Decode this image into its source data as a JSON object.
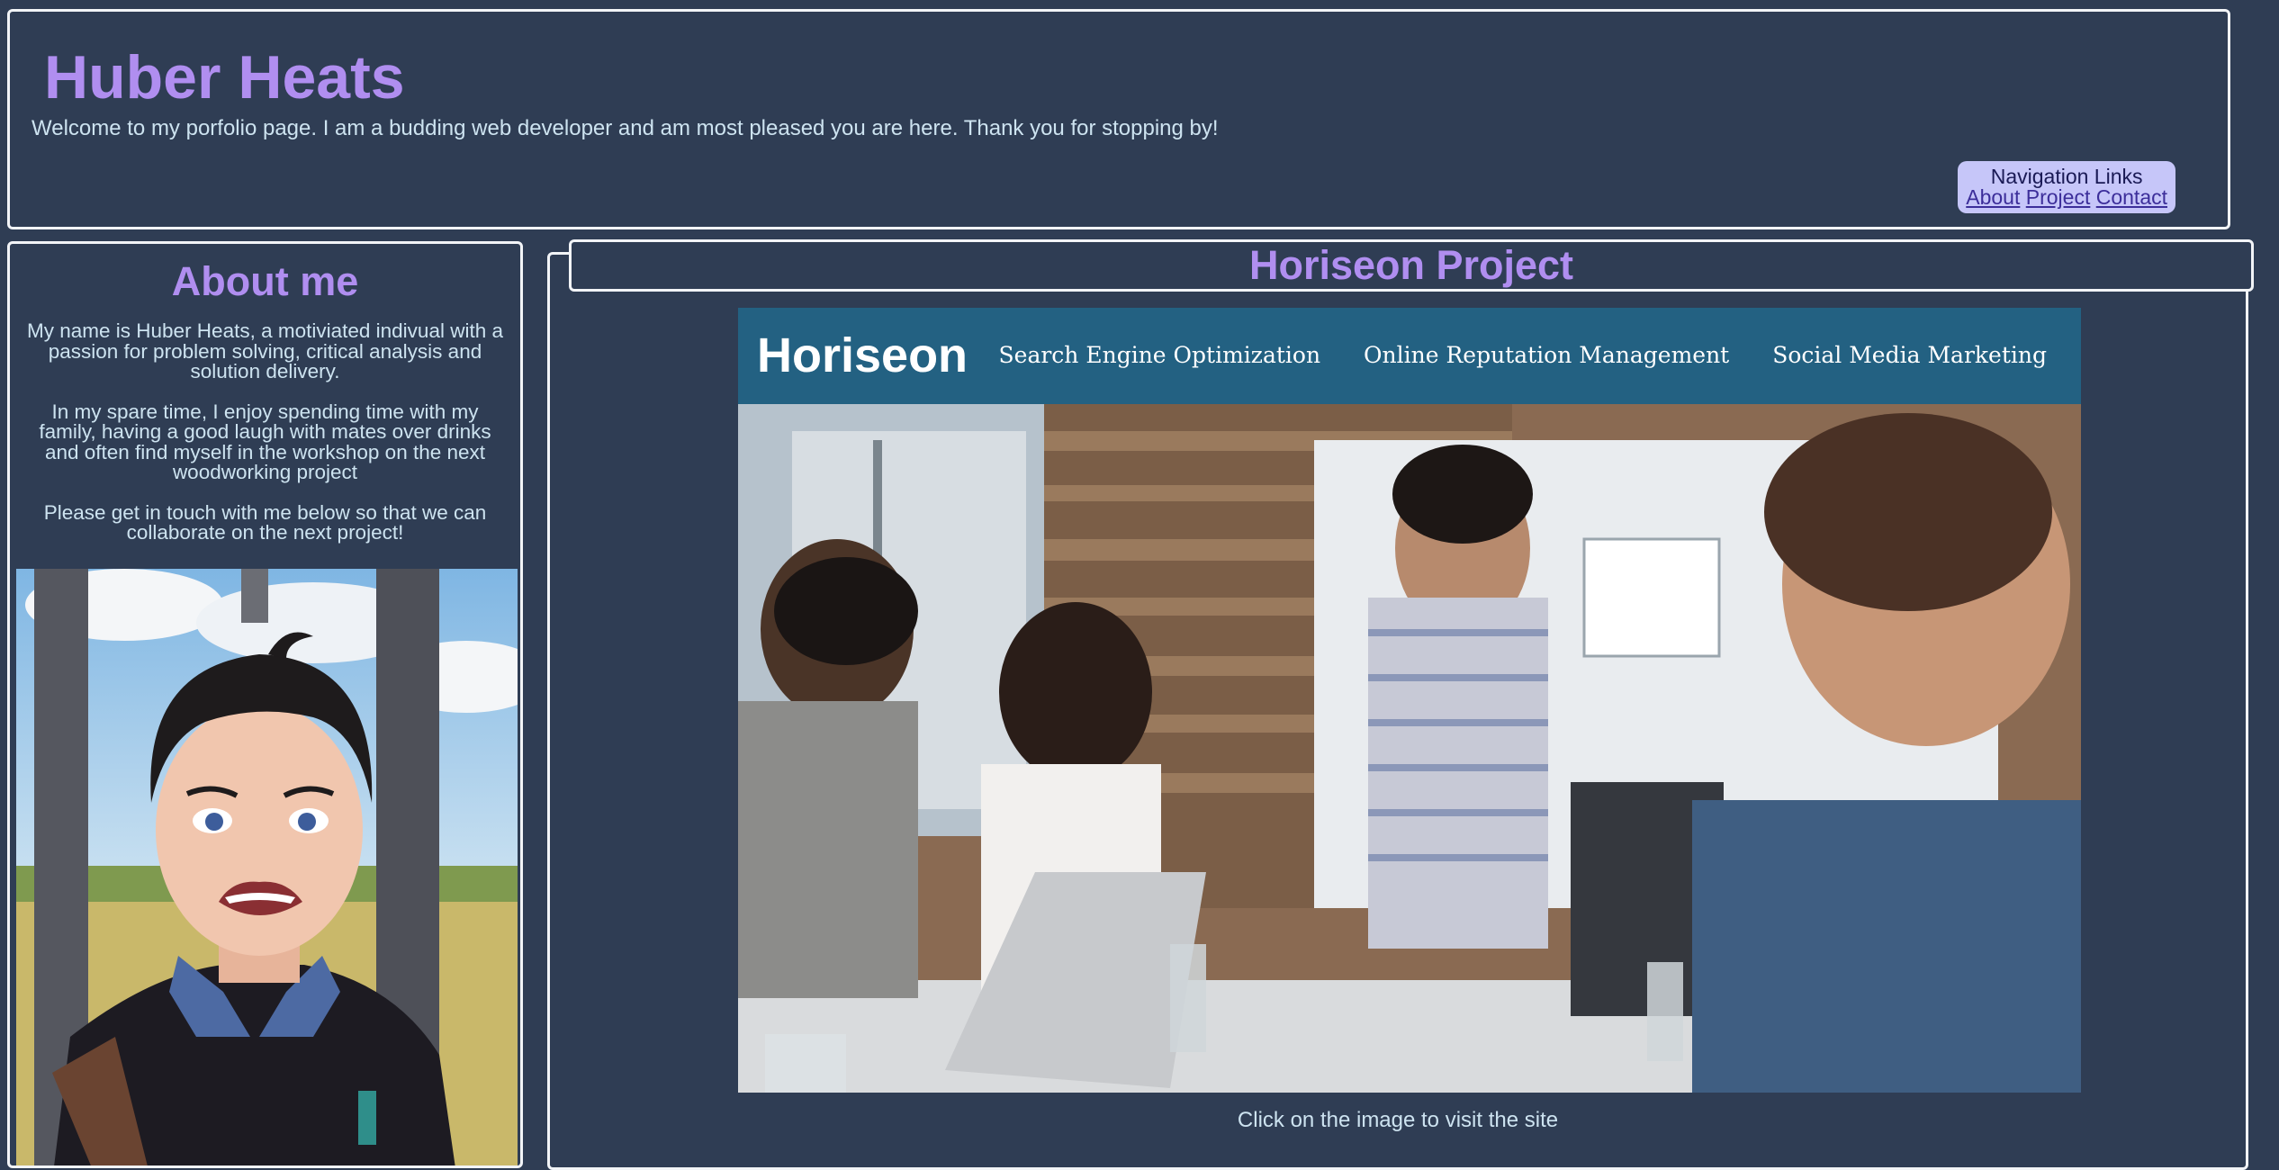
{
  "header": {
    "title": "Huber Heats",
    "welcome": "Welcome to my porfolio page. I am a budding web developer and am most pleased you are here. Thank you for stopping by!",
    "nav": {
      "title": "Navigation Links",
      "links": [
        "About",
        "Project",
        "Contact"
      ]
    }
  },
  "about": {
    "title": "About me",
    "paragraphs": [
      "My name is Huber Heats, a motiviated indivual with a passion for problem solving, critical analysis and solution delivery.",
      "In my spare time, I enjoy spending time with my family, having a good laugh with mates over drinks and often find myself in the workshop on the next woodworking project",
      "Please get in touch with me below so that we can collaborate on the next project!"
    ]
  },
  "project": {
    "title": "Horiseon Project",
    "screenshot": {
      "logo": "Horiseon",
      "nav": [
        "Search Engine Optimization",
        "Online Reputation Management",
        "Social Media Marketing"
      ]
    },
    "caption": "Click on the image to visit the site"
  },
  "colors": {
    "background": "#2f3d54",
    "heading": "#b08ef0",
    "text": "#cde3f0",
    "nav_bg": "#c6c6f9",
    "horiseon_bar": "#236182"
  }
}
